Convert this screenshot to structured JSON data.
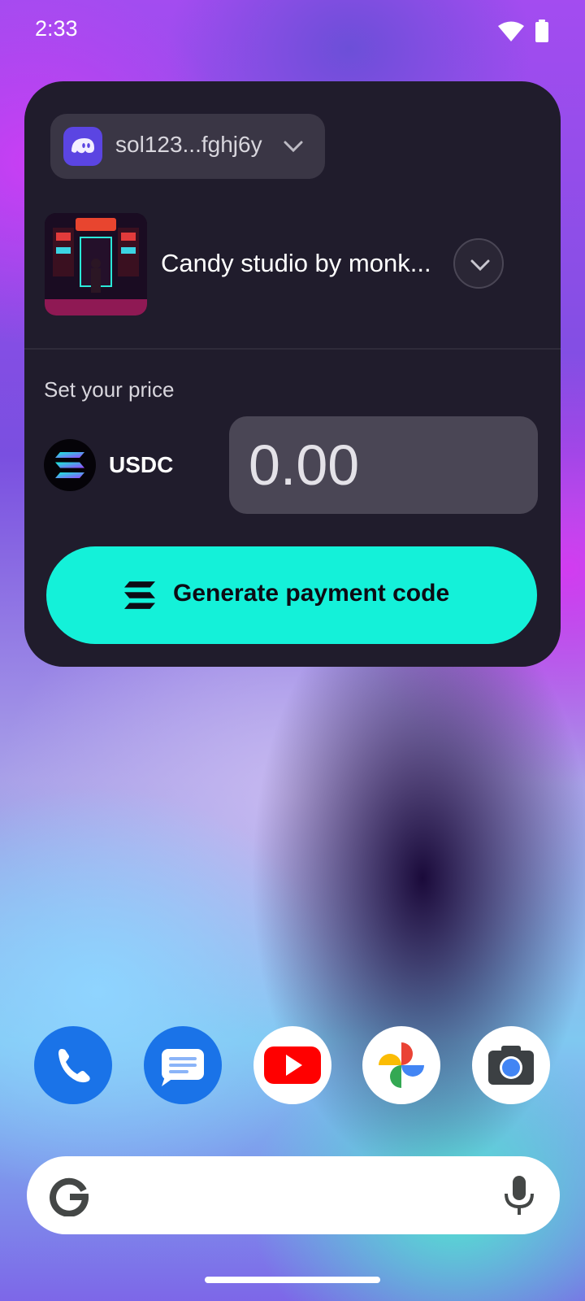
{
  "status_bar": {
    "time": "2:33",
    "icons": [
      "wifi-icon",
      "battery-icon"
    ]
  },
  "widget": {
    "wallet": {
      "icon": "ghost-icon",
      "label": "sol123...fghj6y"
    },
    "nft": {
      "title": "Candy studio by monk..."
    },
    "price": {
      "label": "Set your price",
      "token_icon": "solana-icon",
      "token": "USDC",
      "value": "",
      "placeholder": "0.00"
    },
    "generate_button": {
      "icon": "solana-icon",
      "label": "Generate payment code"
    }
  },
  "dock": {
    "apps": [
      "phone",
      "messages",
      "youtube",
      "photos",
      "camera"
    ]
  },
  "search": {
    "logo": "google-g-icon",
    "mic_icon": "mic-icon"
  },
  "colors": {
    "accent": "#14f1d9",
    "widget_bg": "#201c2c",
    "wallet_icon_bg": "#5b45e2"
  }
}
